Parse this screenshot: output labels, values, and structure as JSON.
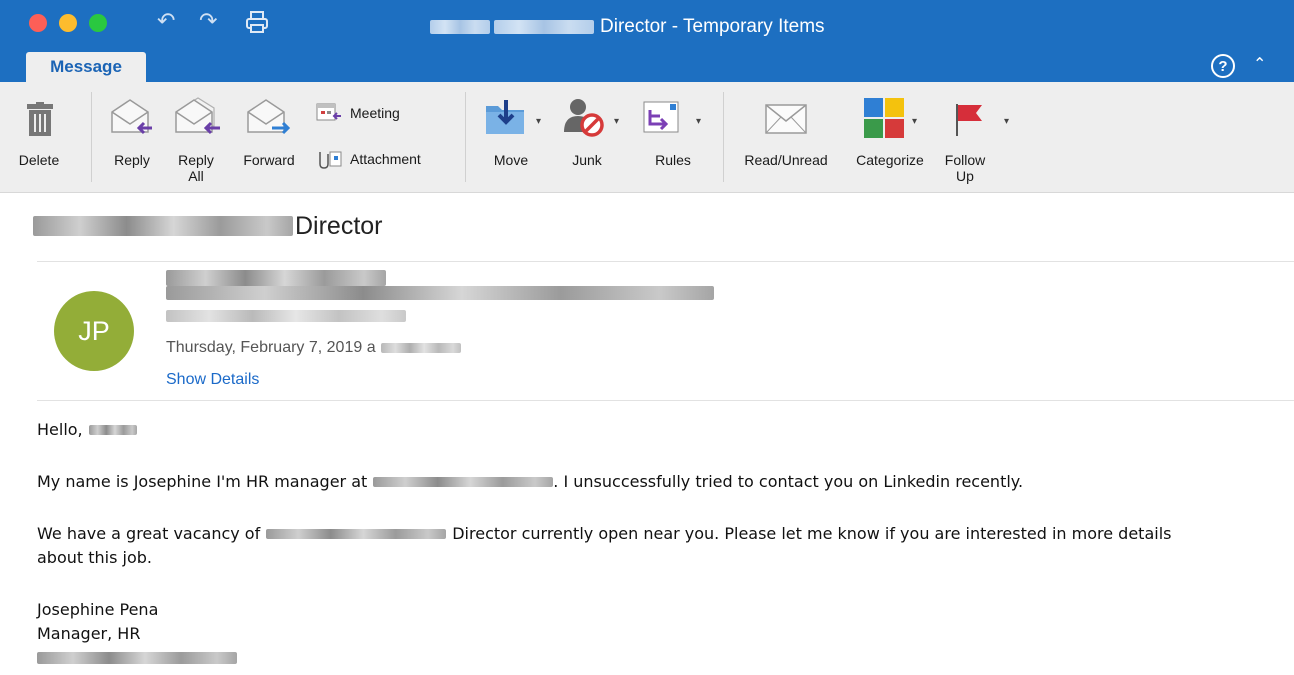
{
  "window": {
    "title_suffix": "Director - Temporary Items"
  },
  "toolbar": {
    "undo_icon": "undo-icon",
    "redo_icon": "redo-icon",
    "print_icon": "print-icon"
  },
  "tabs": [
    {
      "label": "Message",
      "active": true
    }
  ],
  "ribbon": {
    "delete": "Delete",
    "reply": "Reply",
    "reply_all_line1": "Reply",
    "reply_all_line2": "All",
    "forward": "Forward",
    "meeting": "Meeting",
    "attachment": "Attachment",
    "move": "Move",
    "junk": "Junk",
    "rules": "Rules",
    "read_unread": "Read/Unread",
    "categorize": "Categorize",
    "follow_up_line1": "Follow",
    "follow_up_line2": "Up"
  },
  "message": {
    "subject_suffix": "Director",
    "avatar_initials": "JP",
    "date_prefix": "Thursday, February 7, 2019 a",
    "show_details": "Show Details",
    "greeting": "Hello,",
    "para1_start": "My name is Josephine I'm HR manager at",
    "para1_end": ". I unsuccessfully tried to contact you on Linkedin recently.",
    "para2_start": "We have a great vacancy of",
    "para2_end": "Director currently open near you. Please let me know if you are interested in more details",
    "para2_cont": "about this job.",
    "sig_name": "Josephine Pena",
    "sig_title": "Manager, HR"
  },
  "colors": {
    "accent": "#1d6fc1",
    "avatar": "#93ad38",
    "link": "#1b6ac9"
  }
}
